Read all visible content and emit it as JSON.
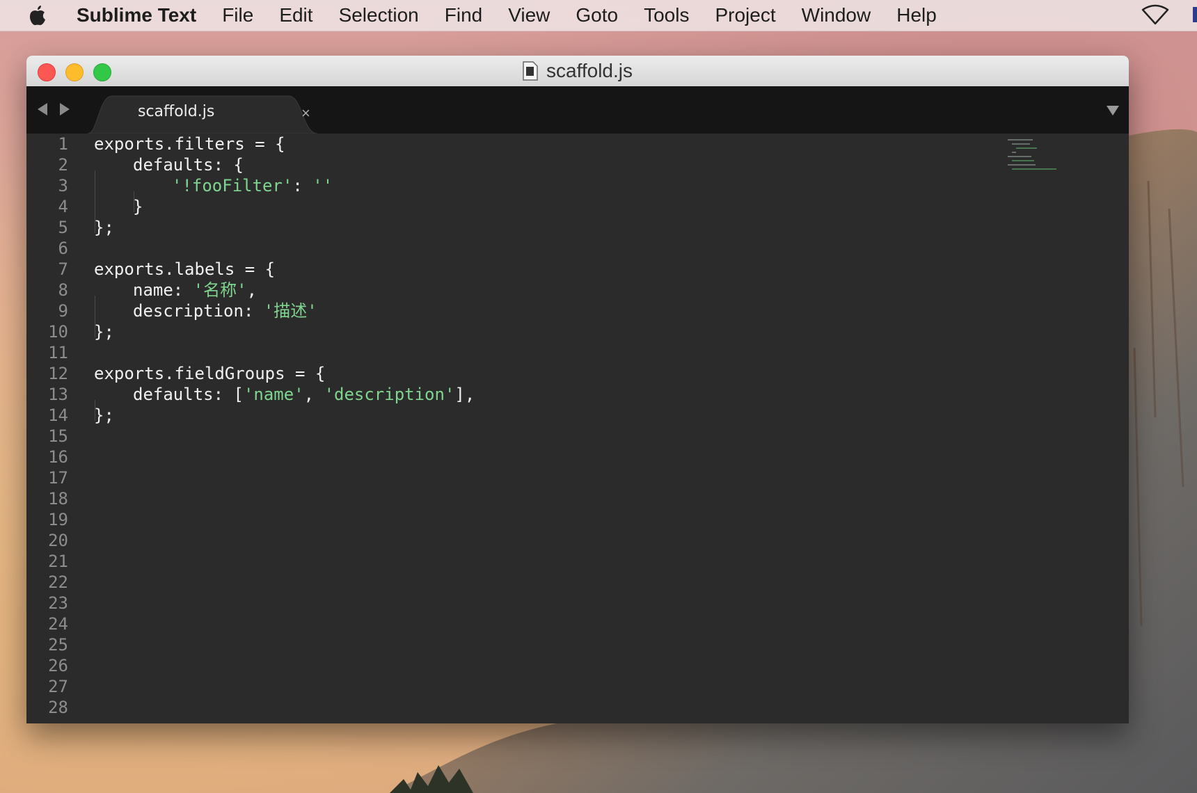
{
  "menubar": {
    "apple_icon": "apple-logo-icon",
    "app_name": "Sublime Text",
    "items": [
      "File",
      "Edit",
      "Selection",
      "Find",
      "View",
      "Goto",
      "Tools",
      "Project",
      "Window",
      "Help"
    ],
    "wifi_icon": "wifi-icon"
  },
  "window": {
    "title": "scaffold.js",
    "title_icon": "document-icon"
  },
  "tabs": [
    {
      "label": "scaffold.js",
      "close_glyph": "×",
      "active": true
    }
  ],
  "editor": {
    "line_numbers": [
      "1",
      "2",
      "3",
      "4",
      "5",
      "6",
      "7",
      "8",
      "9",
      "10",
      "11",
      "12",
      "13",
      "14",
      "15",
      "16",
      "17",
      "18",
      "19",
      "20",
      "21",
      "22",
      "23",
      "24",
      "25",
      "26",
      "27",
      "28"
    ],
    "lines": [
      {
        "indent": 0,
        "tokens": [
          {
            "t": "exports.filters = {",
            "c": "p"
          }
        ]
      },
      {
        "indent": 1,
        "tokens": [
          {
            "t": "defaults: {",
            "c": "p"
          }
        ]
      },
      {
        "indent": 2,
        "tokens": [
          {
            "t": "'!fooFilter'",
            "c": "s"
          },
          {
            "t": ": ",
            "c": "p"
          },
          {
            "t": "''",
            "c": "s"
          }
        ]
      },
      {
        "indent": 1,
        "tokens": [
          {
            "t": "}",
            "c": "p"
          }
        ]
      },
      {
        "indent": 0,
        "tokens": [
          {
            "t": "};",
            "c": "p"
          }
        ]
      },
      {
        "indent": 0,
        "tokens": []
      },
      {
        "indent": 0,
        "tokens": [
          {
            "t": "exports.labels = {",
            "c": "p"
          }
        ]
      },
      {
        "indent": 1,
        "tokens": [
          {
            "t": "name: ",
            "c": "p"
          },
          {
            "t": "'名称'",
            "c": "s"
          },
          {
            "t": ",",
            "c": "p"
          }
        ]
      },
      {
        "indent": 1,
        "tokens": [
          {
            "t": "description: ",
            "c": "p"
          },
          {
            "t": "'描述'",
            "c": "s"
          }
        ]
      },
      {
        "indent": 0,
        "tokens": [
          {
            "t": "};",
            "c": "p"
          }
        ]
      },
      {
        "indent": 0,
        "tokens": []
      },
      {
        "indent": 0,
        "tokens": [
          {
            "t": "exports.fieldGroups = {",
            "c": "p"
          }
        ]
      },
      {
        "indent": 1,
        "tokens": [
          {
            "t": "defaults: [",
            "c": "p"
          },
          {
            "t": "'name'",
            "c": "s"
          },
          {
            "t": ", ",
            "c": "p"
          },
          {
            "t": "'description'",
            "c": "s"
          },
          {
            "t": "],",
            "c": "p"
          }
        ]
      },
      {
        "indent": 0,
        "tokens": [
          {
            "t": "};",
            "c": "p"
          }
        ]
      }
    ]
  },
  "colors": {
    "editor_bg": "#2b2b2b",
    "tabbar_bg": "#151515",
    "string": "#7fd58f",
    "plain": "#f0f0f0",
    "line_number": "#8d8d8d"
  }
}
